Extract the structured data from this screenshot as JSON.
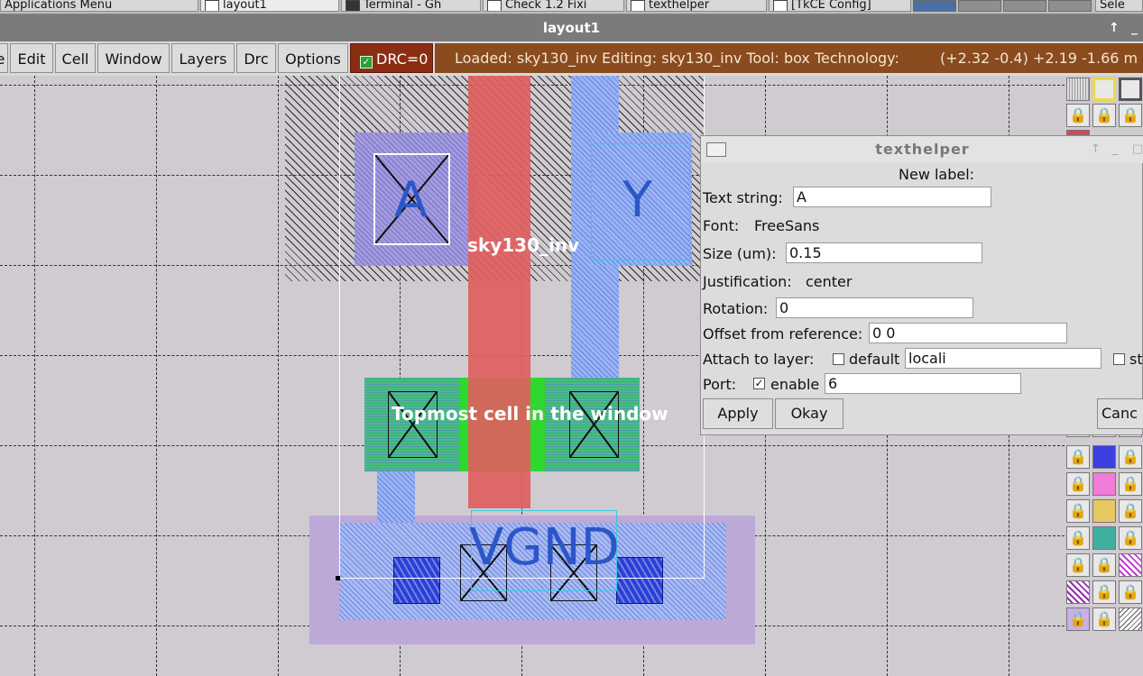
{
  "taskbar": {
    "items": [
      "Applications Menu",
      "layout1",
      "Terminal - Gh",
      "Check 1.2 Fixi",
      "texthelper",
      "[TkCE Config]"
    ],
    "right_label": "Sele"
  },
  "window": {
    "title": "layout1"
  },
  "menu": {
    "items": [
      "Edit",
      "Cell",
      "Window",
      "Layers",
      "Drc",
      "Options"
    ],
    "first_partial": "e"
  },
  "drc": {
    "label": "DRC=0",
    "checked": true
  },
  "status": {
    "text": "Loaded: sky130_inv Editing: sky130_inv Tool: box  Technology:",
    "coords": "(+2.32 -0.4) +2.19 -1.66 m"
  },
  "canvas": {
    "labels": {
      "a": "A",
      "y": "Y",
      "vgnd": "VGND",
      "cell_name": "sky130_inv",
      "topmost": "Topmost cell in the window"
    }
  },
  "texthelper": {
    "title": "texthelper",
    "heading": "New label:",
    "text_string_label": "Text string:",
    "text_string_value": "A",
    "font_label": "Font:",
    "font_value": "FreeSans",
    "size_label": "Size (um):",
    "size_value": "0.15",
    "justification_label": "Justification:",
    "justification_value": "center",
    "rotation_label": "Rotation:",
    "rotation_value": "0",
    "offset_label": "Offset from reference:",
    "offset_value": "0 0",
    "attach_label": "Attach to layer:",
    "default_label": "default",
    "default_checked": false,
    "layer_value": "locali",
    "sticky_label": "st",
    "sticky_checked": false,
    "port_label": "Port:",
    "enable_label": "enable",
    "enable_checked": true,
    "port_value": "6",
    "apply_label": "Apply",
    "okay_label": "Okay",
    "cancel_label": "Canc"
  },
  "colors": {
    "status_bg": "#8a4b1e",
    "drc_bg": "#8b2d12",
    "title_bg": "#7b7b7b",
    "poly": "#e0605e",
    "locali": "#9ab4f2",
    "mcon": "#2a3fd6",
    "label_blue": "#2c56c8"
  }
}
